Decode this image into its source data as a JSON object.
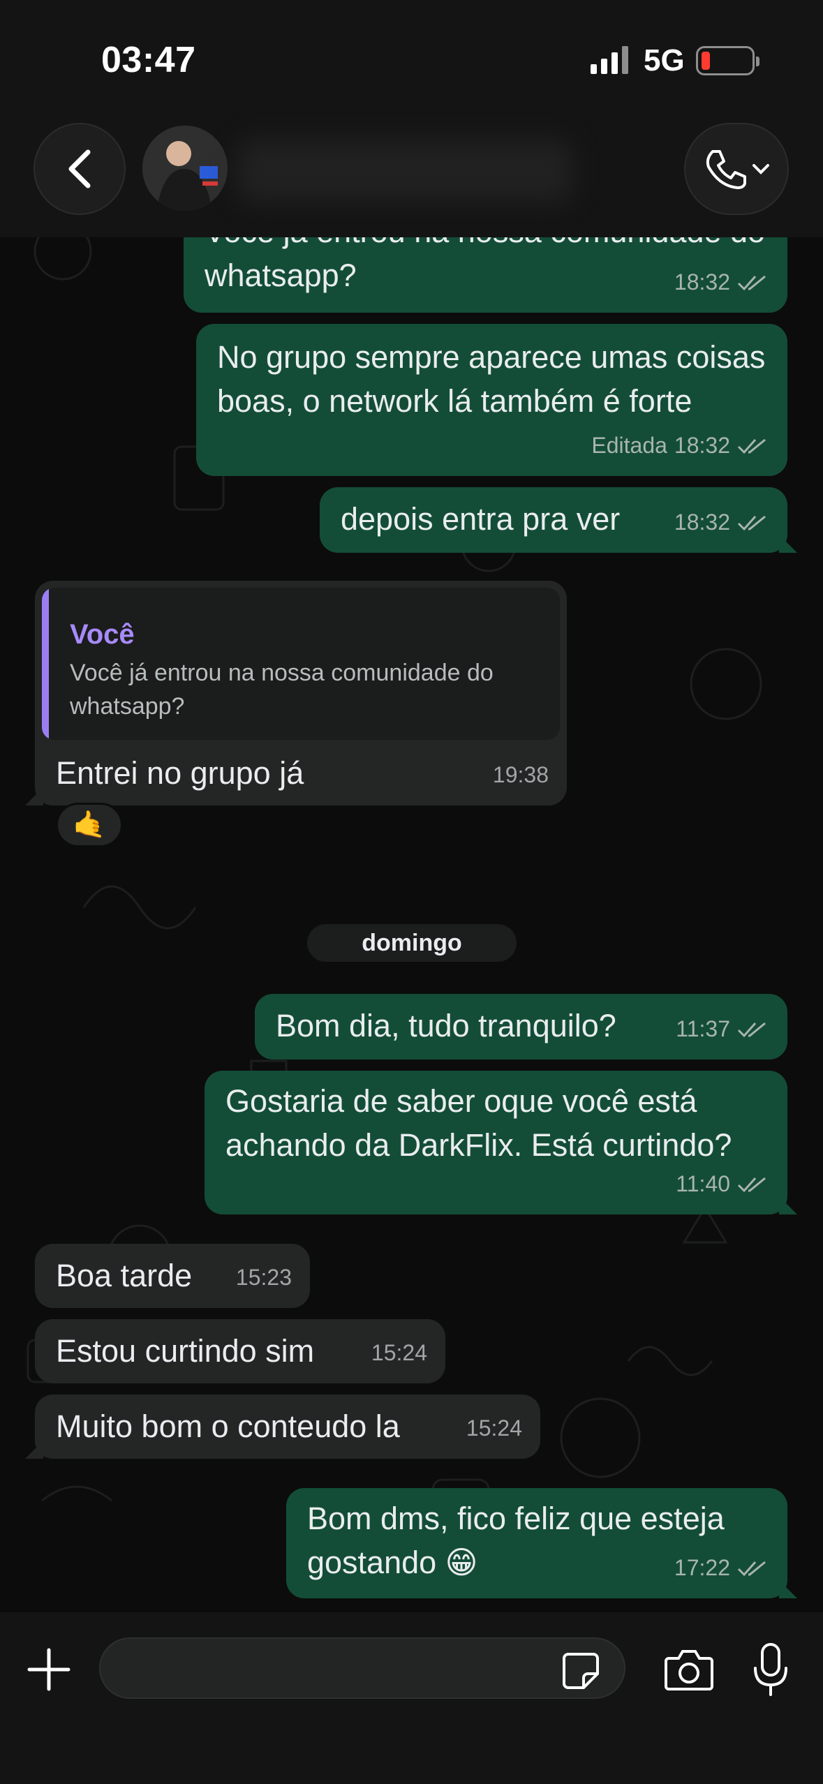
{
  "status_bar": {
    "time": "03:47",
    "network": "5G"
  },
  "header": {
    "back_icon": "chevron-left-icon",
    "call_icon": "phone-with-chevron-icon"
  },
  "messages": [
    {
      "dir": "out",
      "text": "Você já entrou na nossa comunidade do whatsapp?",
      "time": "18:32",
      "read": true
    },
    {
      "dir": "out",
      "text": "No grupo sempre aparece umas coisas boas, o network lá também é forte",
      "edited": "Editada",
      "time": "18:32",
      "read": true
    },
    {
      "dir": "out",
      "text": "depois entra pra ver",
      "time": "18:32",
      "read": true
    },
    {
      "dir": "in",
      "quote_author": "Você",
      "quote_text": "Você já entrou na nossa comunidade do whatsapp?",
      "text": "Entrei no grupo já",
      "time": "19:38",
      "reaction": "🤙"
    },
    {
      "dir": "out",
      "text": "Bom dia, tudo tranquilo?",
      "time": "11:37",
      "read": true
    },
    {
      "dir": "out",
      "text": "Gostaria de saber oque você está achando da DarkFlix. Está curtindo?",
      "time": "11:40",
      "read": true
    },
    {
      "dir": "in",
      "text": "Boa tarde",
      "time": "15:23"
    },
    {
      "dir": "in",
      "text": "Estou curtindo sim",
      "time": "15:24"
    },
    {
      "dir": "in",
      "text": "Muito bom o conteudo la",
      "time": "15:24"
    },
    {
      "dir": "out",
      "text": "Bom dms, fico feliz que esteja gostando 😁",
      "time": "17:22",
      "read": true
    }
  ],
  "date_separator": "domingo",
  "composer": {
    "placeholder": "",
    "icons": [
      "plus-icon",
      "sticker-icon",
      "camera-icon",
      "microphone-icon"
    ]
  },
  "colors": {
    "outgoing_bubble": "#144d37",
    "incoming_bubble": "#242626",
    "quote_accent": "#a78bfa",
    "background": "#0c0c0c"
  }
}
